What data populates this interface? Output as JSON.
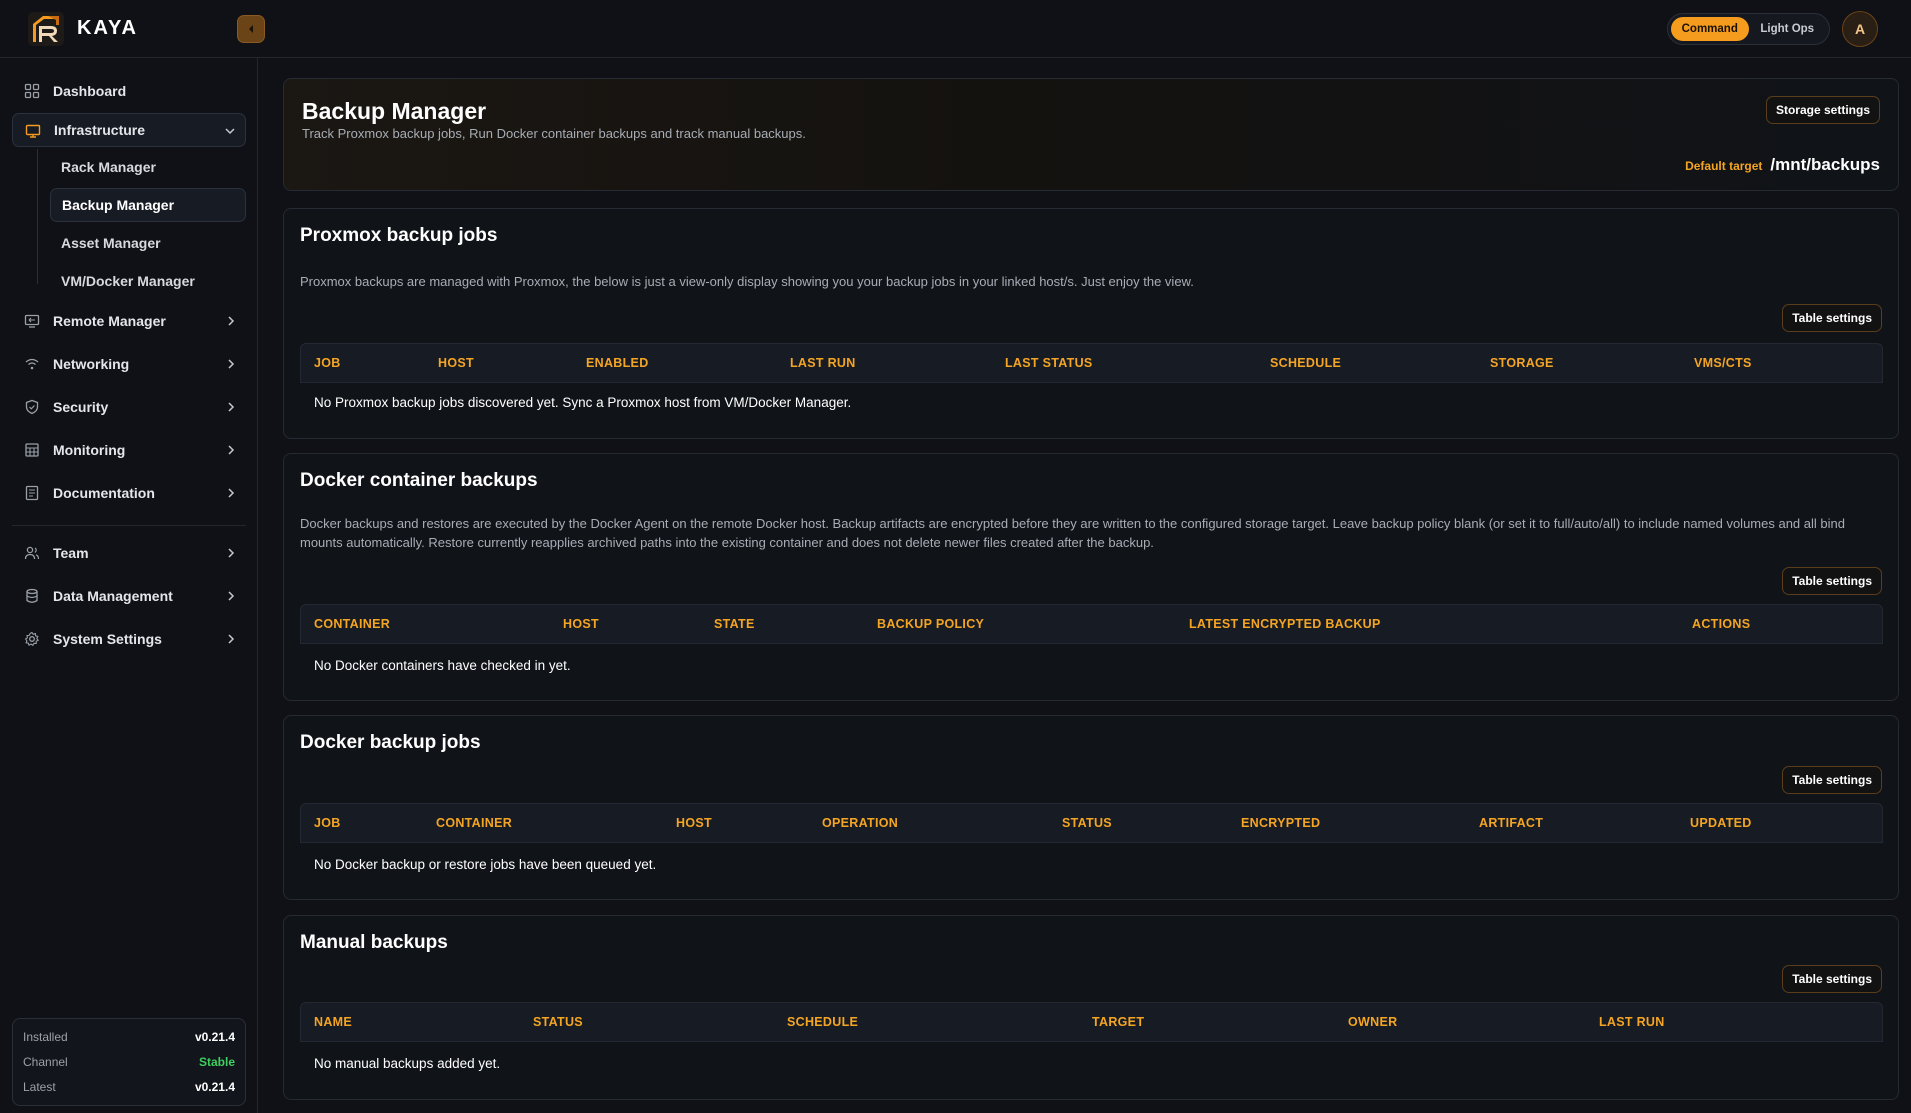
{
  "app": {
    "name": "KAYA"
  },
  "topbar": {
    "mode_options": [
      "Command",
      "Light Ops"
    ],
    "active_mode": "Command",
    "avatar_initial": "A",
    "accent": "#f59b1d"
  },
  "sidebar": {
    "items": [
      {
        "label": "Dashboard",
        "icon": "grid-icon"
      },
      {
        "label": "Infrastructure",
        "icon": "monitor-icon",
        "expanded": true,
        "children": [
          "Rack Manager",
          "Backup Manager",
          "Asset Manager",
          "VM/Docker Manager"
        ],
        "active_child": "Backup Manager"
      },
      {
        "label": "Remote Manager",
        "icon": "remote-icon"
      },
      {
        "label": "Networking",
        "icon": "wifi-icon"
      },
      {
        "label": "Security",
        "icon": "shield-icon"
      },
      {
        "label": "Monitoring",
        "icon": "chart-icon"
      },
      {
        "label": "Documentation",
        "icon": "doc-icon"
      },
      {
        "label": "Team",
        "icon": "users-icon"
      },
      {
        "label": "Data Management",
        "icon": "database-icon"
      },
      {
        "label": "System Settings",
        "icon": "gear-icon"
      }
    ],
    "version": {
      "installed_label": "Installed",
      "installed": "v0.21.4",
      "channel_label": "Channel",
      "channel": "Stable",
      "latest_label": "Latest",
      "latest": "v0.21.4"
    }
  },
  "page": {
    "title": "Backup Manager",
    "subtitle": "Track Proxmox backup jobs, Run Docker container backups and track manual backups.",
    "storage_settings_label": "Storage settings",
    "default_target_label": "Default target",
    "default_target_value": "/mnt/backups"
  },
  "sections": {
    "proxmox": {
      "title": "Proxmox backup jobs",
      "description": "Proxmox backups are managed with Proxmox, the below is just a view-only display showing you your backup jobs in your linked host/s. Just enjoy the view.",
      "table_settings_label": "Table settings",
      "columns": [
        "JOB",
        "HOST",
        "ENABLED",
        "LAST RUN",
        "LAST STATUS",
        "SCHEDULE",
        "STORAGE",
        "VMS/CTS"
      ],
      "empty_message": "No Proxmox backup jobs discovered yet. Sync a Proxmox host from VM/Docker Manager."
    },
    "docker_containers": {
      "title": "Docker container backups",
      "description": "Docker backups and restores are executed by the Docker Agent on the remote Docker host. Backup artifacts are encrypted before they are written to the configured storage target. Leave backup policy blank (or set it to full/auto/all) to include named volumes and all bind mounts automatically. Restore currently reapplies archived paths into the existing container and does not delete newer files created after the backup.",
      "table_settings_label": "Table settings",
      "columns": [
        "CONTAINER",
        "HOST",
        "STATE",
        "BACKUP POLICY",
        "LATEST ENCRYPTED BACKUP",
        "ACTIONS"
      ],
      "empty_message": "No Docker containers have checked in yet."
    },
    "docker_jobs": {
      "title": "Docker backup jobs",
      "table_settings_label": "Table settings",
      "columns": [
        "JOB",
        "CONTAINER",
        "HOST",
        "OPERATION",
        "STATUS",
        "ENCRYPTED",
        "ARTIFACT",
        "UPDATED"
      ],
      "empty_message": "No Docker backup or restore jobs have been queued yet."
    },
    "manual": {
      "title": "Manual backups",
      "table_settings_label": "Table settings",
      "columns": [
        "NAME",
        "STATUS",
        "SCHEDULE",
        "TARGET",
        "OWNER",
        "LAST RUN"
      ],
      "empty_message": "No manual backups added yet."
    }
  }
}
